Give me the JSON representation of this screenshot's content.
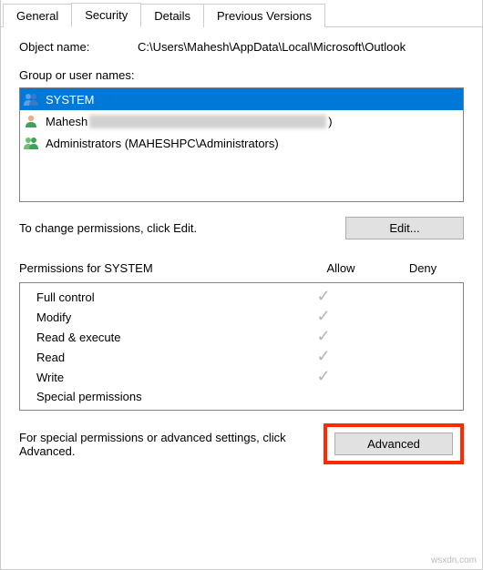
{
  "tabs": {
    "general": "General",
    "security": "Security",
    "details": "Details",
    "previous": "Previous Versions"
  },
  "object": {
    "label": "Object name:",
    "value": "C:\\Users\\Mahesh\\AppData\\Local\\Microsoft\\Outlook"
  },
  "groupsLabel": "Group or user names:",
  "groups": [
    {
      "name": "SYSTEM",
      "redacted": "",
      "suffix": ""
    },
    {
      "name": "Mahesh",
      "redacted": "xxxxxxxxxxxxxxxxxxxxxxxxxxxxxxxxxxxxxxxx",
      "suffix": ")"
    },
    {
      "name": "Administrators (MAHESHPC\\Administrators)",
      "redacted": "",
      "suffix": ""
    }
  ],
  "editRow": {
    "text": "To change permissions, click Edit.",
    "button": "Edit..."
  },
  "permHeader": {
    "title": "Permissions for SYSTEM",
    "allow": "Allow",
    "deny": "Deny"
  },
  "permissions": [
    {
      "name": "Full control",
      "allow": true,
      "deny": false
    },
    {
      "name": "Modify",
      "allow": true,
      "deny": false
    },
    {
      "name": "Read & execute",
      "allow": true,
      "deny": false
    },
    {
      "name": "Read",
      "allow": true,
      "deny": false
    },
    {
      "name": "Write",
      "allow": true,
      "deny": false
    },
    {
      "name": "Special permissions",
      "allow": false,
      "deny": false
    }
  ],
  "advanced": {
    "text": "For special permissions or advanced settings, click Advanced.",
    "button": "Advanced"
  },
  "watermark": "wsxdn.com"
}
